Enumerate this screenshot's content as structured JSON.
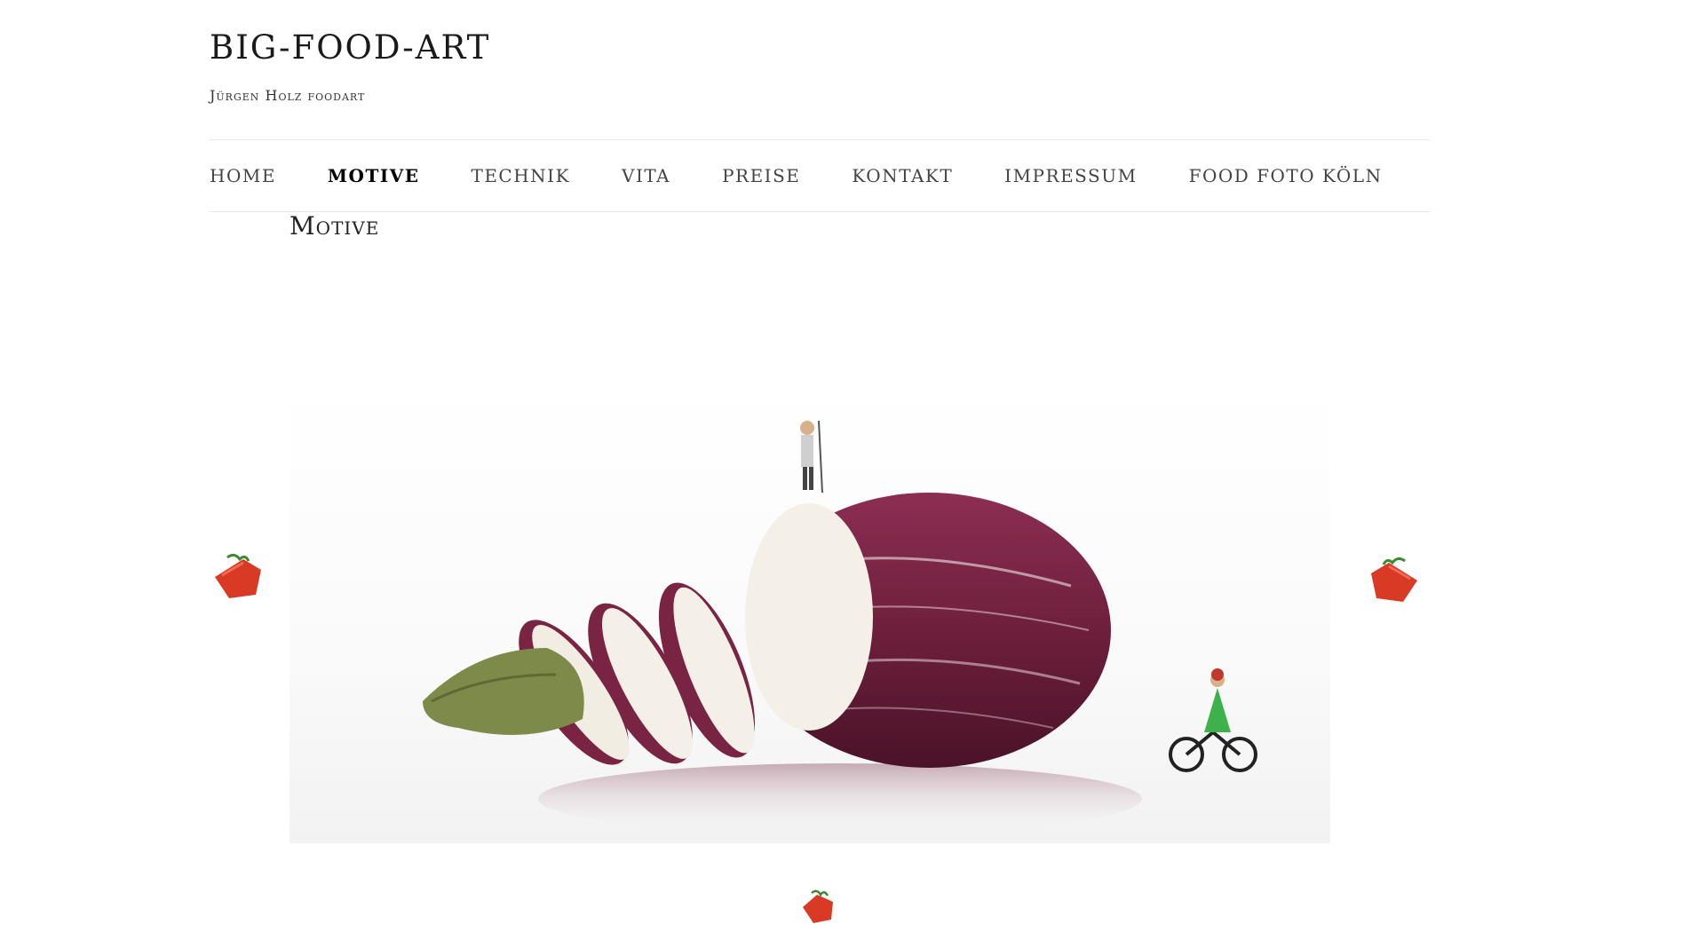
{
  "site": {
    "title": "BIG-FOOD-ART",
    "tagline": "Jürgen Holz foodart"
  },
  "nav": {
    "items": [
      {
        "label": "HOME",
        "active": false
      },
      {
        "label": "MOTIVE",
        "active": true
      },
      {
        "label": "TECHNIK",
        "active": false
      },
      {
        "label": "VITA",
        "active": false
      },
      {
        "label": "PREISE",
        "active": false
      },
      {
        "label": "KONTAKT",
        "active": false
      },
      {
        "label": "IMPRESSUM",
        "active": false
      },
      {
        "label": "FOOD FOTO KÖLN",
        "active": false
      }
    ]
  },
  "page": {
    "heading": "Motive"
  },
  "slider": {
    "image_subject": "eggplant-with-miniature-figures",
    "prev_icon": "tomato-arrow-left-icon",
    "next_icon": "tomato-arrow-right-icon",
    "pager_icon": "tomato-dot-icon"
  },
  "colors": {
    "accent": "#d93a25",
    "eggplant": "#6e1f3c",
    "text": "#222222",
    "rule": "#e6e6e6"
  }
}
